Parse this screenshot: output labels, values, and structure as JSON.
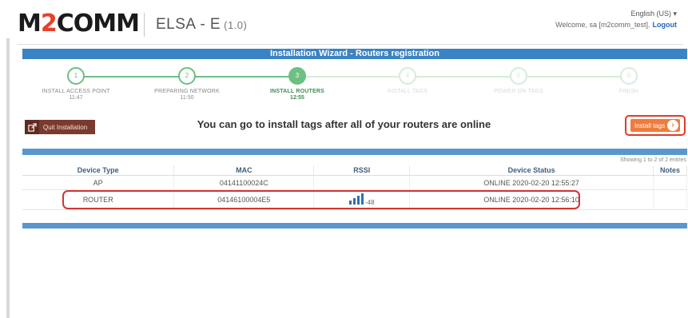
{
  "header": {
    "logo_left": "M",
    "logo_accent": "2",
    "logo_right": "COMM",
    "app_name": "ELSA - E",
    "app_version": "(1.0)",
    "language": "English (US) ▾",
    "welcome": "Welcome, sa [m2comm_test].",
    "logout": "Logout"
  },
  "wizard": {
    "title": "Installation Wizard - Routers registration",
    "steps": [
      {
        "num": "1",
        "label": "INSTALL ACCESS POINT",
        "time": "11:47",
        "state": "done"
      },
      {
        "num": "2",
        "label": "PREPARING NETWORK",
        "time": "11:50",
        "state": "done"
      },
      {
        "num": "3",
        "label": "INSTALL ROUTERS",
        "time": "12:55",
        "state": "active"
      },
      {
        "num": "4",
        "label": "INSTALL TAGS",
        "time": "",
        "state": "todo"
      },
      {
        "num": "5",
        "label": "POWER ON TAGS",
        "time": "",
        "state": "todo"
      },
      {
        "num": "6",
        "label": "FINISH",
        "time": "",
        "state": "todo"
      }
    ]
  },
  "actions": {
    "quit_label": "Quit Installation",
    "message": "You can go to install tags after all of your routers are online",
    "install_tags_label": "Install tags"
  },
  "table": {
    "showing": "Showing 1 to 2 of 2 entries",
    "columns": [
      "Device Type",
      "MAC",
      "RSSI",
      "Device Status",
      "Notes"
    ],
    "rows": [
      {
        "device_type": "AP",
        "mac": "04141100024C",
        "rssi": "",
        "status": "ONLINE 2020-02-20 12:55:27",
        "notes": ""
      },
      {
        "device_type": "ROUTER",
        "mac": "04146100004E5",
        "rssi": "-48",
        "status": "ONLINE 2020-02-20 12:56:10",
        "notes": ""
      }
    ]
  },
  "colors": {
    "brand_blue": "#3a83c4",
    "step_green": "#6cc082",
    "highlight_red": "#d33434",
    "install_orange": "#f07b3c",
    "quit_brown": "#7a3a2e"
  },
  "icons": {
    "quit": "exit-arrow-icon",
    "install": "arrow-right-circle-icon",
    "rssi": "signal-bars-icon"
  }
}
